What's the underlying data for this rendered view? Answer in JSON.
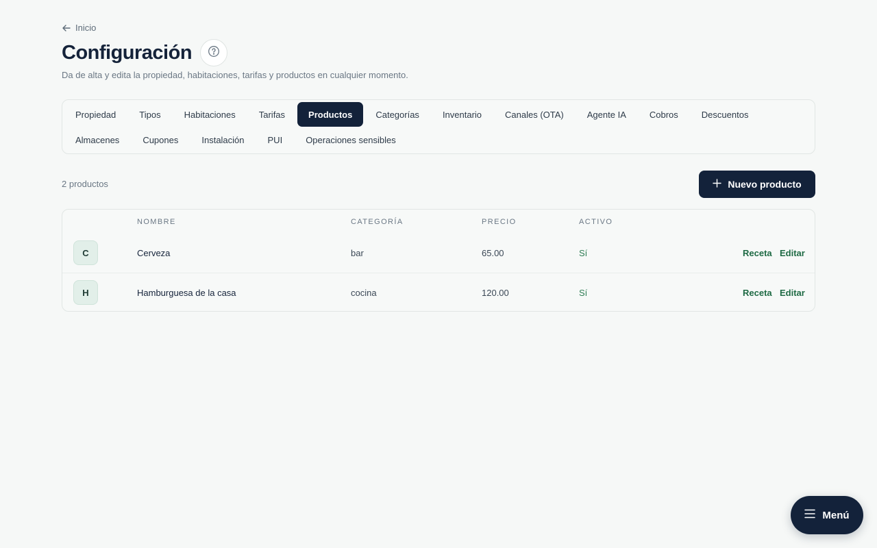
{
  "breadcrumb": {
    "label": "Inicio",
    "icon": "arrow-left-icon"
  },
  "header": {
    "title": "Configuración",
    "subtitle": "Da de alta y edita la propiedad, habitaciones, tarifas y productos en cualquier momento.",
    "help_icon": "question-circle-icon"
  },
  "tabs": {
    "row1": [
      "Propiedad",
      "Tipos",
      "Habitaciones",
      "Tarifas",
      "Productos",
      "Categorías",
      "Inventario",
      "Canales (OTA)",
      "Agente IA",
      "Cobros",
      "Descuentos"
    ],
    "row2": [
      "Almacenes",
      "Cupones",
      "Instalación",
      "PUI",
      "Operaciones sensibles"
    ],
    "active": "Productos"
  },
  "toolbar": {
    "count_label": "2 productos",
    "new_button_label": "Nuevo producto",
    "new_button_icon": "plus-icon"
  },
  "table": {
    "columns": {
      "name": "NOMBRE",
      "category": "CATEGORÍA",
      "price": "PRECIO",
      "active": "ACTIVO"
    },
    "rows": [
      {
        "initial": "C",
        "name": "Cerveza",
        "category": "bar",
        "price": "65.00",
        "active": "Sí",
        "recipe": "Receta",
        "edit": "Editar"
      },
      {
        "initial": "H",
        "name": "Hamburguesa de la casa",
        "category": "cocina",
        "price": "120.00",
        "active": "Sí",
        "recipe": "Receta",
        "edit": "Editar"
      }
    ]
  },
  "fab": {
    "label": "Menú",
    "icon": "hamburger-menu-icon"
  },
  "colors": {
    "background": "#f6f8f7",
    "primary": "#13223a",
    "accent_green": "#1e6a44",
    "active_green": "#2e7d54"
  }
}
